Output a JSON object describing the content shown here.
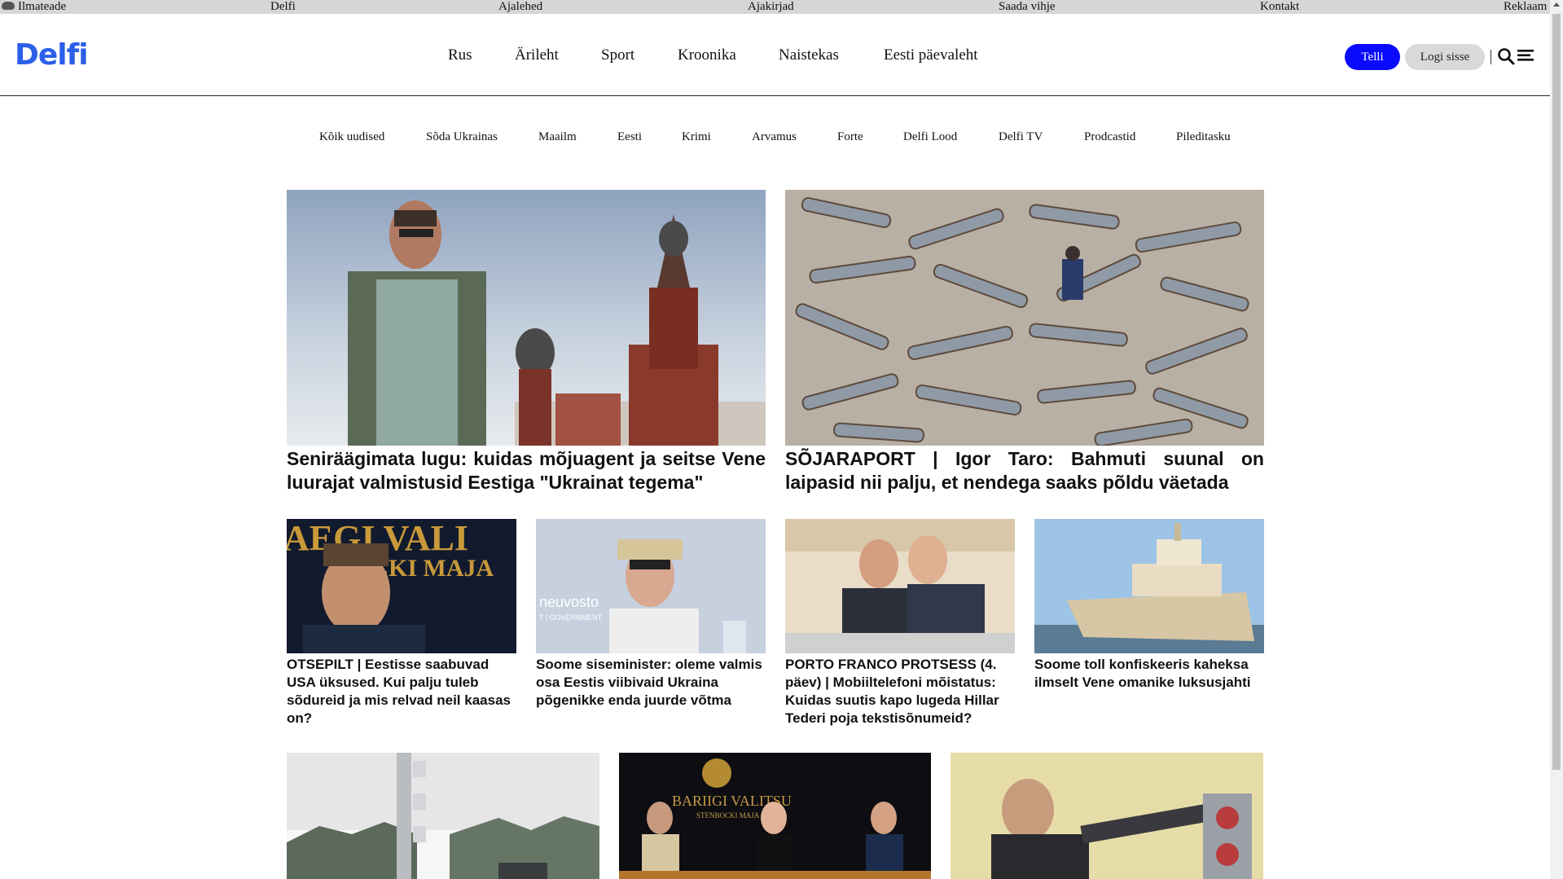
{
  "topbar": {
    "weather": "Ilmateade",
    "delfi": "Delfi",
    "newspapers": "Ajalehed",
    "magazines": "Ajakirjad",
    "tip": "Saada vihje",
    "contact": "Kontakt",
    "ads": "Reklaam"
  },
  "header": {
    "logo": "Delfi",
    "nav": [
      "Rus",
      "Ärileht",
      "Sport",
      "Kroonika",
      "Naistekas",
      "Eesti päevaleht"
    ],
    "subscribe": "Telli",
    "login": "Logi sisse"
  },
  "subnav": [
    "Kõik uudised",
    "Sõda Ukrainas",
    "Maailm",
    "Eesti",
    "Krimi",
    "Arvamus",
    "Forte",
    "Delfi Lood",
    "Delfi TV",
    "Prodcastid",
    "Pileditasku"
  ],
  "articles": {
    "big": [
      {
        "headline": "Seniräägimata lugu: kuidas mõjuagent ja seitse Vene luurajat valmistusid Eestiga \"Ukrainat tegema\""
      },
      {
        "headline": "SÕJARAPORT | Igor Taro: Bahmuti suunal on laipasid nii palju, et nendega saaks põldu väetada"
      }
    ],
    "small": [
      {
        "headline": "OTSEPILT | Eestisse saabuvad USA üksused. Kui palju tuleb sõdureid ja mis relvad neil kaasas on?"
      },
      {
        "headline": "Soome siseminister: oleme valmis osa Eestis viibivaid Ukraina põgenikke enda juurde võtma"
      },
      {
        "headline": "PORTO FRANCO PROTSESS (4. päev) | Mobiiltelefoni mõistatus: Kuidas suutis kapo lugeda Hillar Tederi poja tekstisõnumeid?"
      },
      {
        "headline": "Soome toll konfiskeeris kaheksa ilmselt Vene omanike luksusjahti"
      }
    ]
  },
  "image_text": {
    "img3_sign": "AEGI VALI",
    "img3_sign2": "BOCKI MAJA",
    "img4_sign": "neuvosto",
    "img4_sign2": "T | GOVERNMENT",
    "row3_img2_sign": "BARIIGI VALITSU",
    "row3_img2_sign2": "STENBOCKI MAJA"
  },
  "colors": {
    "brand": "#2c5fe8",
    "subscribe_bg": "#0a0aff",
    "login_bg": "#d9d9d9",
    "topbar_bg": "#d6d6d6"
  },
  "icons": {
    "weather": "cloud-icon",
    "search": "search-icon",
    "menu": "hamburger-menu-icon",
    "collapse": "caret-up-icon"
  }
}
